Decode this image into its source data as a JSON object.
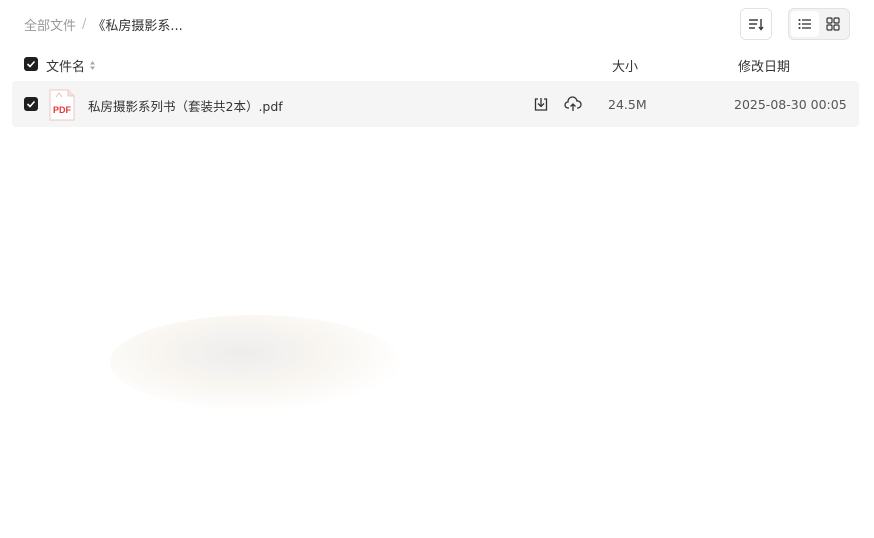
{
  "breadcrumb": {
    "root": "全部文件",
    "separator": "/",
    "current": "《私房摄影系..."
  },
  "toolbar": {
    "sort_icon": "sort-lines-icon",
    "view_list_icon": "list-view-icon",
    "view_grid_icon": "grid-view-icon",
    "active_view": "list"
  },
  "list": {
    "columns": {
      "name": "文件名",
      "size": "大小",
      "date": "修改日期"
    },
    "header_checked": true,
    "rows": [
      {
        "checked": true,
        "icon_label": "PDF",
        "name": "私房摄影系列书（套装共2本）.pdf",
        "size": "24.5M",
        "modified": "2025-08-30 00:05"
      }
    ]
  },
  "colors": {
    "pdf_red": "#e5383b",
    "checkbox": "#1f1f1f",
    "row_bg": "#f5f5f5"
  }
}
